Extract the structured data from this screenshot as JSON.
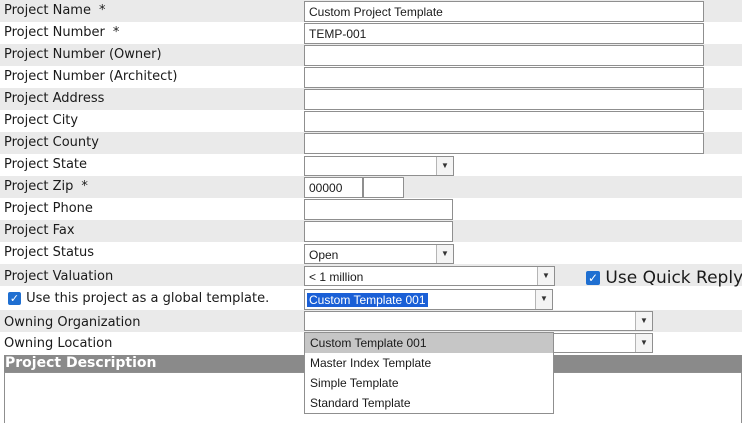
{
  "fields": {
    "project_name": {
      "label": "Project Name",
      "required": "*",
      "value": "Custom Project Template"
    },
    "project_number": {
      "label": "Project Number",
      "required": "*",
      "value": "TEMP-001"
    },
    "project_number_owner": {
      "label": "Project Number (Owner)",
      "value": ""
    },
    "project_number_architect": {
      "label": "Project Number (Architect)",
      "value": ""
    },
    "project_address": {
      "label": "Project Address",
      "value": ""
    },
    "project_city": {
      "label": "Project City",
      "value": ""
    },
    "project_county": {
      "label": "Project County",
      "value": ""
    },
    "project_state": {
      "label": "Project State",
      "value": ""
    },
    "project_zip": {
      "label": "Project Zip",
      "required": "*",
      "value": "00000",
      "ext_value": ""
    },
    "project_phone": {
      "label": "Project Phone",
      "value": ""
    },
    "project_fax": {
      "label": "Project Fax",
      "value": ""
    },
    "project_status": {
      "label": "Project Status",
      "value": "Open"
    },
    "project_valuation": {
      "label": "Project Valuation",
      "value": "< 1 million"
    },
    "owning_organization": {
      "label": "Owning Organization",
      "value": ""
    },
    "owning_location": {
      "label": "Owning Location",
      "value": ""
    }
  },
  "quick_reply": {
    "label": "Use Quick Reply",
    "checked": true
  },
  "global_template": {
    "label": "Use this project as a global template.",
    "checked": true,
    "selected": "Custom Template 001",
    "options": [
      "Custom Template 001",
      "Master Index Template",
      "Simple Template",
      "Standard Template"
    ]
  },
  "description": {
    "header": "Project Description",
    "value": ""
  },
  "colors": {
    "row_alt": "#eaeaea",
    "header_bg": "#8a8a8a",
    "checkbox": "#1f6fd1",
    "selection": "#1a5fd6"
  }
}
